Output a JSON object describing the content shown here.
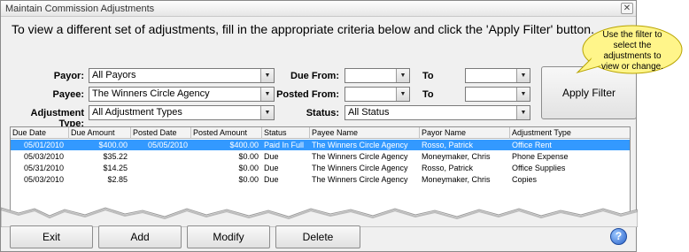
{
  "window": {
    "title": "Maintain Commission Adjustments",
    "close_glyph": "✕"
  },
  "instructions": "To view a different set of adjustments, fill in the appropriate criteria below and click the 'Apply Filter' button.",
  "filters": {
    "payor_label": "Payor:",
    "payor_value": "All Payors",
    "payee_label": "Payee:",
    "payee_value": "The Winners Circle Agency",
    "adjustment_type_label": "Adjustment Type:",
    "adjustment_type_value": "All Adjustment Types",
    "due_from_label": "Due From:",
    "due_from_value": "",
    "due_to_label": "To",
    "due_to_value": "",
    "posted_from_label": "Posted From:",
    "posted_from_value": "",
    "posted_to_label": "To",
    "posted_to_value": "",
    "status_label": "Status:",
    "status_value": "All Status"
  },
  "apply_button": "Apply Filter",
  "callout": "Use the filter to select the adjustments to view or change.",
  "grid": {
    "columns": [
      "Due Date",
      "Due Amount",
      "Posted Date",
      "Posted Amount",
      "Status",
      "Payee Name",
      "Payor Name",
      "Adjustment Type"
    ],
    "rows": [
      [
        "05/01/2010",
        "$400.00",
        "05/05/2010",
        "$400.00",
        "Paid In Full",
        "The Winners Circle Agency",
        "Rosso, Patrick",
        "Office Rent"
      ],
      [
        "05/03/2010",
        "$35.22",
        "",
        "$0.00",
        "Due",
        "The Winners Circle Agency",
        "Moneymaker, Chris",
        "Phone Expense"
      ],
      [
        "05/31/2010",
        "$14.25",
        "",
        "$0.00",
        "Due",
        "The Winners Circle Agency",
        "Rosso, Patrick",
        "Office Supplies"
      ],
      [
        "05/03/2010",
        "$2.85",
        "",
        "$0.00",
        "Due",
        "The Winners Circle Agency",
        "Moneymaker, Chris",
        "Copies"
      ]
    ],
    "selected_row": 0
  },
  "buttons": {
    "exit": "Exit",
    "add": "Add",
    "modify": "Modify",
    "delete": "Delete"
  },
  "help_glyph": "?",
  "colors": {
    "selection": "#3399ff",
    "callout_fill": "#fff58a",
    "help": "#2a62c9"
  },
  "icons": [
    "close-icon",
    "dropdown-arrow-icon",
    "help-icon"
  ]
}
